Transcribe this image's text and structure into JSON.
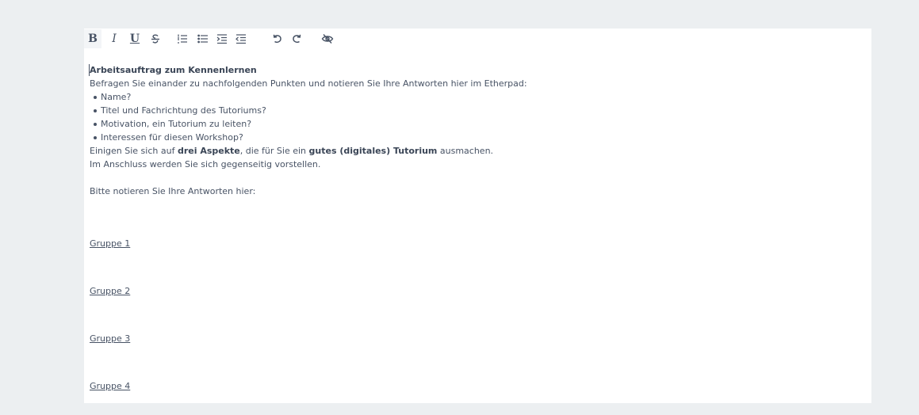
{
  "toolbar": {
    "bold_label": "B",
    "italic_label": "I",
    "underline_label": "U",
    "icons": [
      "bold",
      "italic",
      "underline",
      "strikethrough-icon",
      "ordered-list-icon",
      "unordered-list-icon",
      "indent-icon",
      "outdent-icon",
      "undo-icon",
      "redo-icon",
      "eye-slash-icon"
    ]
  },
  "document": {
    "title": "Arbeitsauftrag zum Kennenlernen",
    "intro": "Befragen Sie einander zu nachfolgenden Punkten und notieren Sie Ihre Antworten hier im Etherpad:",
    "bullets": [
      "Name?",
      "Titel und Fachrichtung des Tutoriums?",
      "Motivation, ein Tutorium zu leiten?",
      "Interessen für diesen Workshop?"
    ],
    "agree_prefix": "Einigen Sie sich auf ",
    "agree_bold1": "drei Aspekte",
    "agree_middle": ", die für Sie ein ",
    "agree_bold2": "gutes (digitales) Tutorium",
    "agree_suffix": " ausmachen.",
    "followup": "Im Anschluss werden Sie sich gegenseitig vorstellen.",
    "prompt": "Bitte notieren Sie Ihre Antworten hier:",
    "groups": [
      "Gruppe 1",
      "Gruppe 2",
      "Gruppe 3",
      "Gruppe 4"
    ]
  }
}
